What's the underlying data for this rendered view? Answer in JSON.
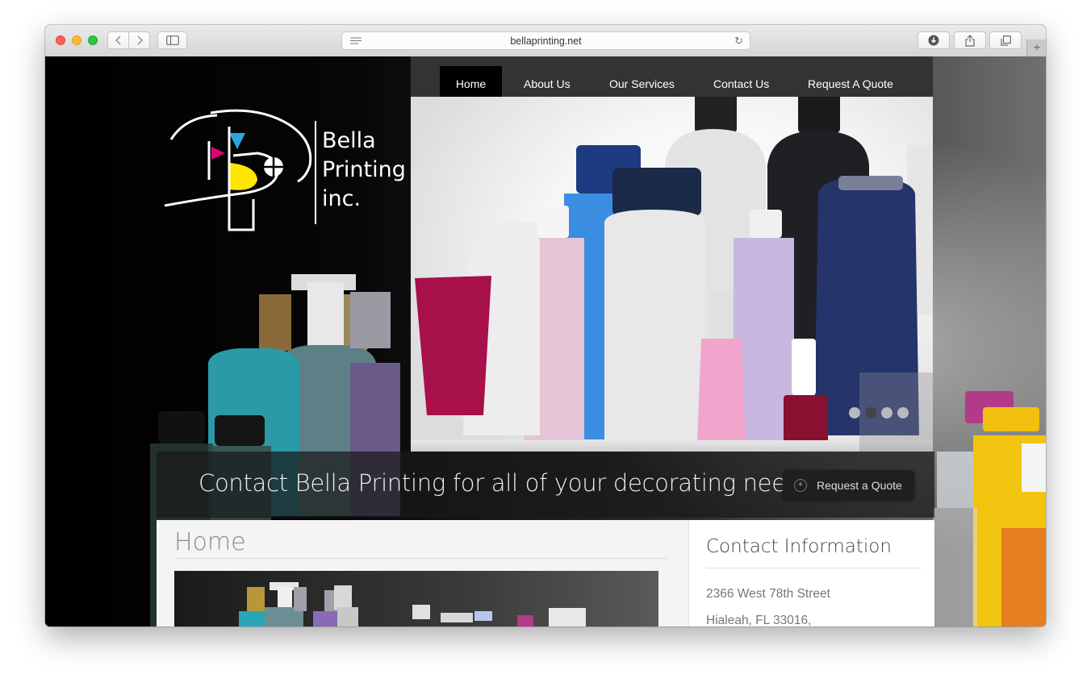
{
  "browser": {
    "url": "bellaprinting.net"
  },
  "logo": {
    "lines": [
      "Bella",
      "Printing",
      "inc."
    ]
  },
  "nav": {
    "items": [
      {
        "label": "Home",
        "active": true
      },
      {
        "label": "About Us",
        "active": false
      },
      {
        "label": "Our Services",
        "active": false
      },
      {
        "label": "Contact Us",
        "active": false
      },
      {
        "label": "Request A Quote",
        "active": false
      }
    ]
  },
  "slider": {
    "count": 4,
    "active_index": 1
  },
  "banner": {
    "tagline": "Contact Bella Printing for all of your decorating needs !",
    "quote_button": "Request a Quote"
  },
  "content": {
    "title": "Home"
  },
  "sidebar": {
    "title": "Contact Information",
    "address_line1": "2366 West 78th Street",
    "address_line2": "Hialeah, FL 33016,"
  },
  "colors": {
    "nav_bg": "#333333",
    "nav_active": "#000000",
    "logo_cyan": "#29a8e0",
    "logo_magenta": "#e6007e",
    "logo_yellow": "#ffe600"
  }
}
